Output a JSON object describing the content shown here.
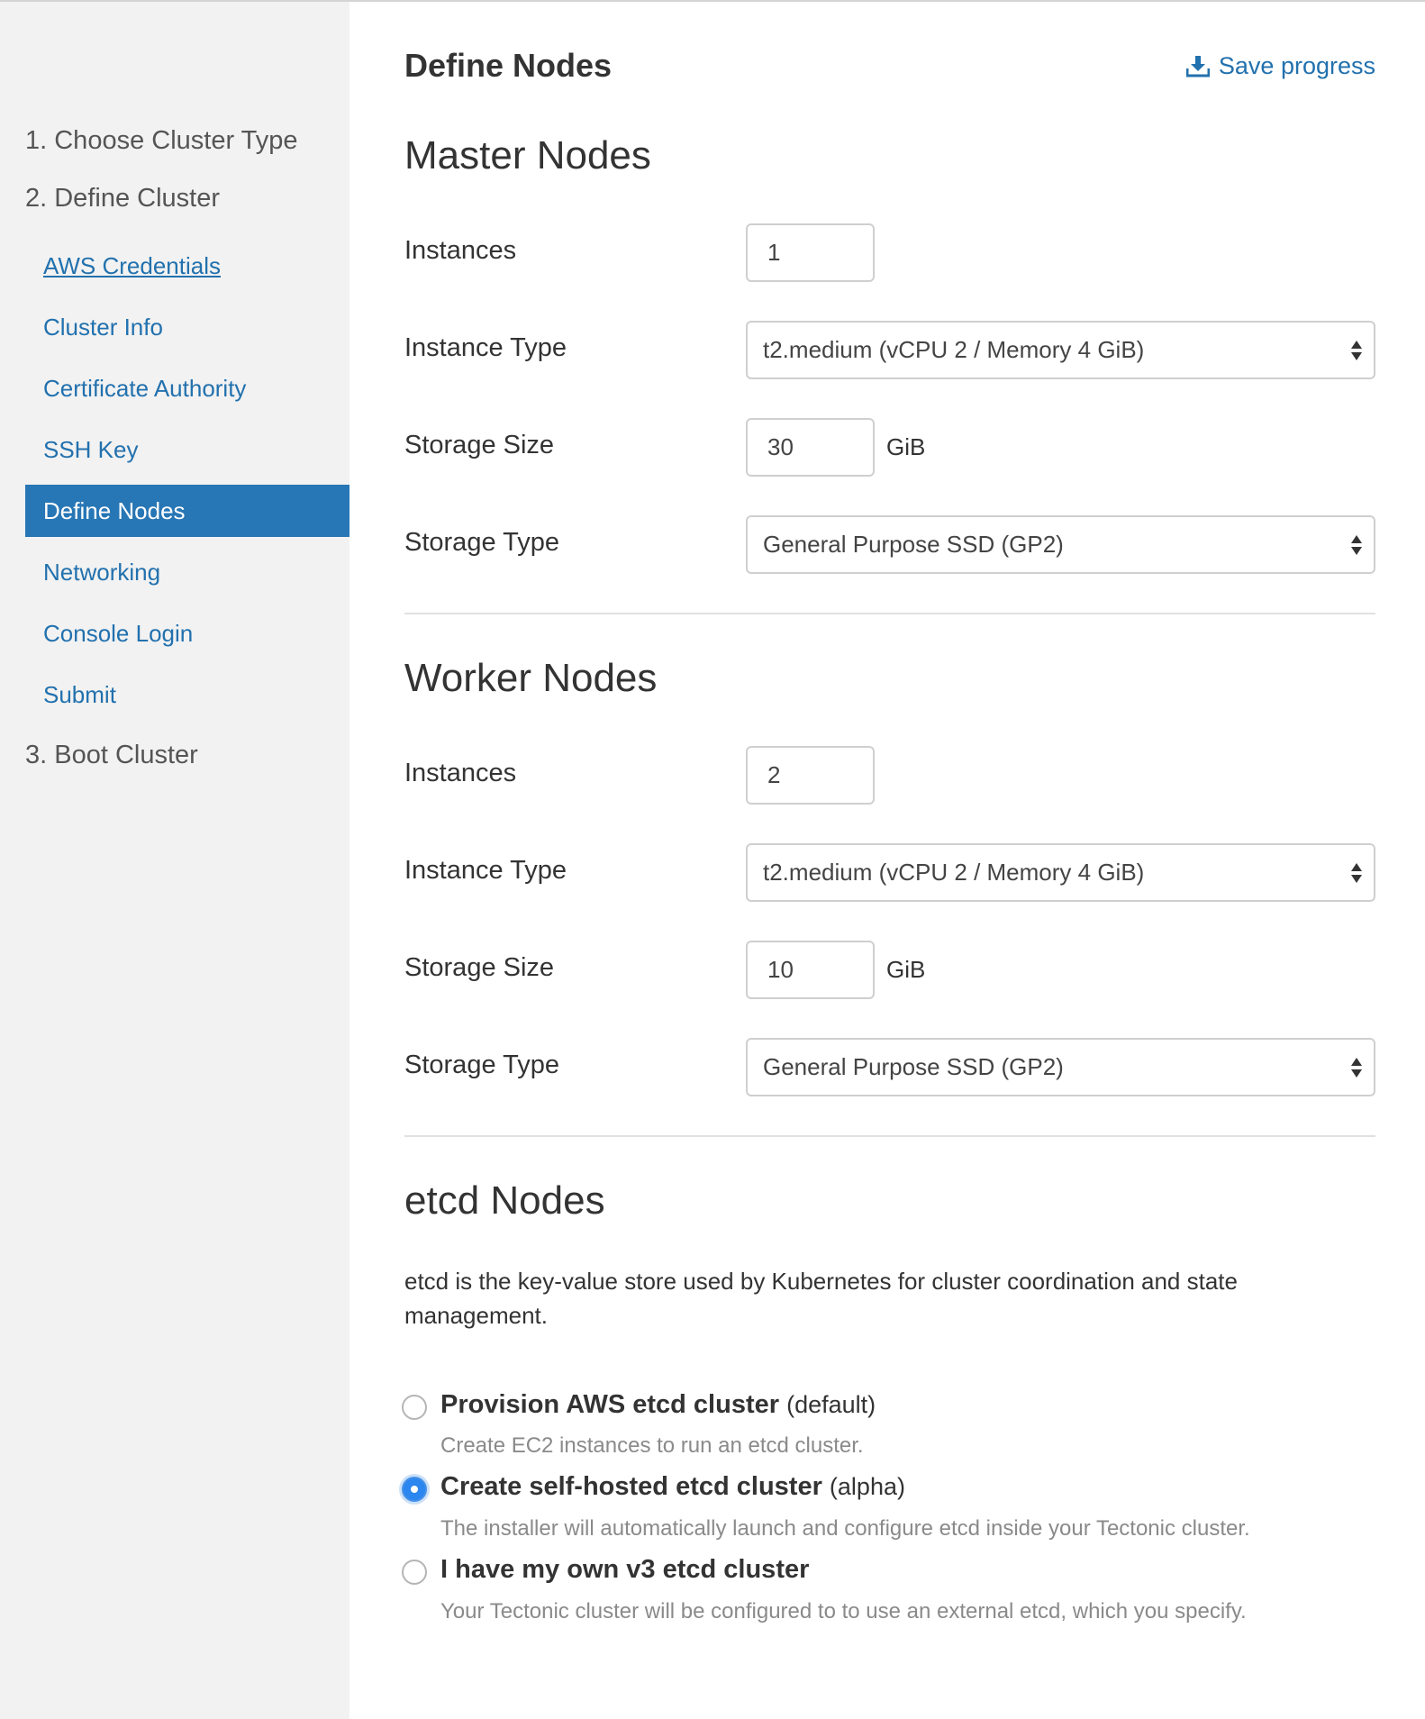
{
  "sidebar": {
    "steps": [
      {
        "label": "1. Choose Cluster Type"
      },
      {
        "label": "2. Define Cluster"
      },
      {
        "label": "3. Boot Cluster"
      }
    ],
    "items": [
      {
        "label": "AWS Credentials"
      },
      {
        "label": "Cluster Info"
      },
      {
        "label": "Certificate Authority"
      },
      {
        "label": "SSH Key"
      },
      {
        "label": "Define Nodes"
      },
      {
        "label": "Networking"
      },
      {
        "label": "Console Login"
      },
      {
        "label": "Submit"
      }
    ],
    "active_item": "Define Nodes"
  },
  "header": {
    "title": "Define Nodes",
    "save_label": "Save progress",
    "save_icon": "download-icon"
  },
  "master": {
    "title": "Master Nodes",
    "instances_label": "Instances",
    "instances_value": "1",
    "instance_type_label": "Instance Type",
    "instance_type_value": "t2.medium (vCPU 2 / Memory 4 GiB)",
    "storage_size_label": "Storage Size",
    "storage_size_value": "30",
    "storage_size_unit": "GiB",
    "storage_type_label": "Storage Type",
    "storage_type_value": "General Purpose SSD (GP2)"
  },
  "worker": {
    "title": "Worker Nodes",
    "instances_label": "Instances",
    "instances_value": "2",
    "instance_type_label": "Instance Type",
    "instance_type_value": "t2.medium (vCPU 2 / Memory 4 GiB)",
    "storage_size_label": "Storage Size",
    "storage_size_value": "10",
    "storage_size_unit": "GiB",
    "storage_type_label": "Storage Type",
    "storage_type_value": "General Purpose SSD (GP2)"
  },
  "etcd": {
    "title": "etcd Nodes",
    "description": "etcd is the key-value store used by Kubernetes for cluster coordination and state management.",
    "options": [
      {
        "title": "Provision AWS etcd cluster",
        "tag": "(default)",
        "desc": "Create EC2 instances to run an etcd cluster.",
        "checked": false
      },
      {
        "title": "Create self-hosted etcd cluster",
        "tag": "(alpha)",
        "desc": "The installer will automatically launch and configure etcd inside your Tectonic cluster.",
        "checked": true
      },
      {
        "title": "I have my own v3 etcd cluster",
        "tag": "",
        "desc": "Your Tectonic cluster will be configured to to use an external etcd, which you specify.",
        "checked": false
      }
    ]
  },
  "colors": {
    "accent": "#2271ae",
    "active_bg": "#2776b5",
    "radio_checked": "#2b86f0",
    "sidebar_bg": "#f2f2f2"
  }
}
